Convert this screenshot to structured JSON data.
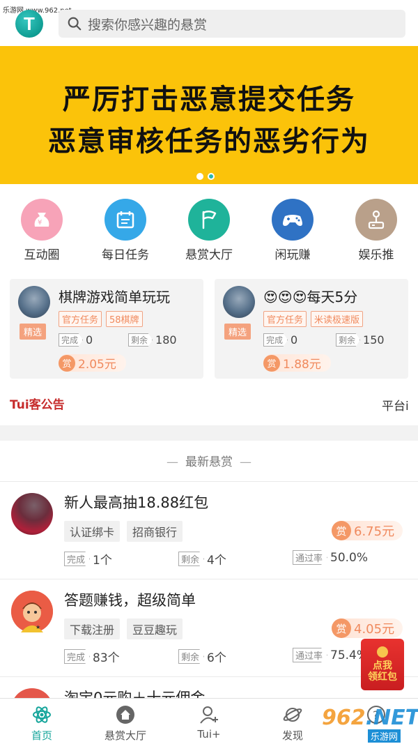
{
  "watermark": {
    "top_left": "乐游网 www.962.net",
    "brand": "962",
    "brand_net": ".NET",
    "brand_cn": "乐游网"
  },
  "header": {
    "logo_letter": "T",
    "search_placeholder": "搜索你感兴趣的悬赏"
  },
  "banner": {
    "line1": "严厉打击恶意提交任务",
    "line2": "恶意审核任务的恶劣行为",
    "bg_color": "#fbc30a"
  },
  "categories": [
    {
      "label": "互动圈",
      "icon": "money-bag-icon",
      "color": "#f7a3b8"
    },
    {
      "label": "每日任务",
      "icon": "calendar-icon",
      "color": "#35a8e8"
    },
    {
      "label": "悬赏大厅",
      "icon": "flag-icon",
      "color": "#1fb39a"
    },
    {
      "label": "闲玩赚",
      "icon": "gamepad-icon",
      "color": "#2f72c4"
    },
    {
      "label": "娱乐推",
      "icon": "joystick-icon",
      "color": "#b9a08a"
    }
  ],
  "featured": [
    {
      "badge": "精选",
      "title": "棋牌游戏简单玩玩",
      "tags": [
        "官方任务",
        "58棋牌"
      ],
      "done_label": "完成",
      "done": "0",
      "left_label": "剩余",
      "left": "180",
      "reward_badge": "赏",
      "reward": "2.05元"
    },
    {
      "badge": "精选",
      "title": "😍😍😍每天5分",
      "tags": [
        "官方任务",
        "米读极速版"
      ],
      "done_label": "完成",
      "done": "0",
      "left_label": "剩余",
      "left": "150",
      "reward_badge": "赏",
      "reward": "1.88元"
    }
  ],
  "notice": {
    "label": "Tui客公告",
    "text": "平台i"
  },
  "section_title": "最新悬赏",
  "tasks": [
    {
      "title": "新人最高抽18.88红包",
      "tags": [
        "认证绑卡",
        "招商银行"
      ],
      "reward_badge": "赏",
      "reward": "6.75元",
      "done_label": "完成",
      "done": "1个",
      "left_label": "剩余",
      "left": "4个",
      "rate_label": "通过率",
      "rate": "50.0%"
    },
    {
      "title": "答题赚钱，超级简单",
      "tags": [
        "下载注册",
        "豆豆趣玩"
      ],
      "reward_badge": "赏",
      "reward": "4.05元",
      "done_label": "完成",
      "done": "83个",
      "left_label": "剩余",
      "left": "6个",
      "rate_label": "通过率",
      "rate": "75.4%"
    },
    {
      "title": "淘宝0元购＋十元佣金"
    }
  ],
  "redpack": {
    "line1": "点我",
    "line2": "领红包"
  },
  "bottom_nav": [
    {
      "label": "首页",
      "icon": "atom-icon",
      "active": true
    },
    {
      "label": "悬赏大厅",
      "icon": "home-icon",
      "active": false
    },
    {
      "label": "Tui+",
      "icon": "add-user-icon",
      "active": false
    },
    {
      "label": "发现",
      "icon": "planet-icon",
      "active": false
    },
    {
      "label": "",
      "icon": "help-icon",
      "active": false
    }
  ],
  "colors": {
    "accent": "#15a59b",
    "reward": "#f08a5e",
    "notice": "#c62b2b"
  }
}
